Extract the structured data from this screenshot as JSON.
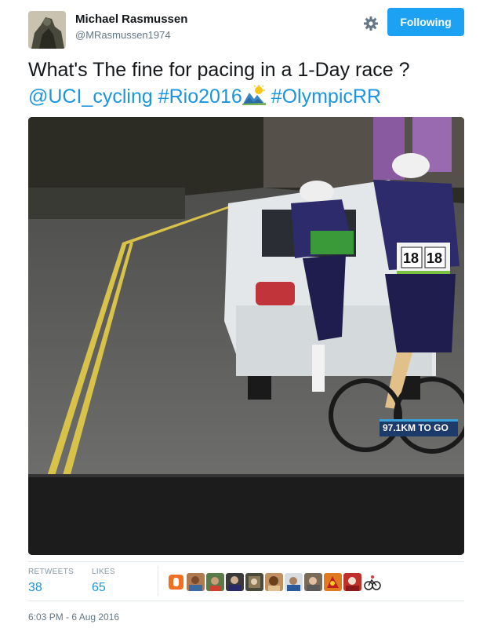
{
  "author": {
    "name": "Michael Rasmussen",
    "handle": "@MRasmussen1974"
  },
  "follow_button": {
    "label": "Following"
  },
  "tweet": {
    "text": "What's The fine for pacing in a 1-Day race ?",
    "mention": "@UCI_cycling",
    "hashtag1": "#Rio2016",
    "emoji": "mountain-sun-emoji",
    "hashtag2": "#OlympicRR"
  },
  "media": {
    "overlay_text": "97.1KM TO GO",
    "bib_number": "18",
    "colors": {
      "road": "#5a5a5a",
      "car": "#e8ecef",
      "jersey": "#2d2b6b"
    }
  },
  "stats": {
    "retweets_label": "RETWEETS",
    "retweets_value": "38",
    "likes_label": "LIKES",
    "likes_value": "65"
  },
  "likers": [
    "liker-avatar",
    "liker-avatar",
    "liker-avatar",
    "liker-avatar",
    "liker-avatar",
    "liker-avatar",
    "liker-avatar",
    "liker-avatar",
    "liker-avatar",
    "liker-avatar",
    "liker-avatar"
  ],
  "timestamp": "6:03 PM - 6 Aug 2016",
  "colors": {
    "link": "#1b95e0",
    "button": "#1da1f2",
    "muted": "#657786"
  }
}
